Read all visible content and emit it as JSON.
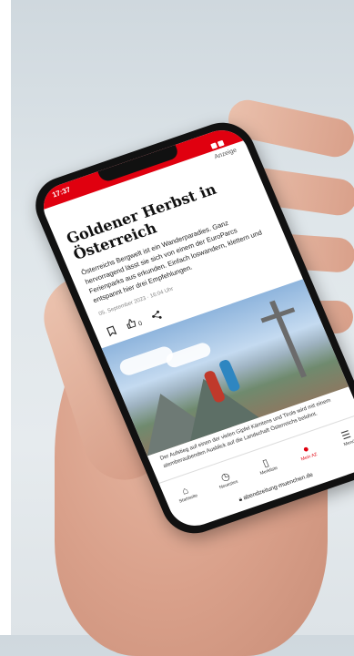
{
  "phone": {
    "status_time": "17:37",
    "ad_label": "Anzeige",
    "article": {
      "headline": "Goldener Herbst in Österreich",
      "teaser": "Österreichs Bergwelt ist ein Wanderparadies. Ganz hervorragend lässt sie sich von einem der EuroParcs Ferienparks aus erkunden. Einfach loswandern, klettern und entspannt hier drei Empfehlungen.",
      "date": "05. September 2023 · 16:04 Uhr",
      "like_count": "0",
      "caption": "Der Aufstieg auf einen der vielen Gipfel Kärntens und Tirols wird mit einem atemberaubenden Ausblick auf die Landschaft Österreichs belohnt."
    },
    "tabs": [
      {
        "label": "Startseite",
        "icon": "home-icon",
        "glyph": "⌂"
      },
      {
        "label": "Neuestes",
        "icon": "clock-icon",
        "glyph": "◷"
      },
      {
        "label": "Merkliste",
        "icon": "bookmark-icon",
        "glyph": "▯"
      },
      {
        "label": "Mein AZ",
        "icon": "user-icon",
        "glyph": "●"
      },
      {
        "label": "Menü",
        "icon": "menu-icon",
        "glyph": "☰"
      }
    ],
    "url": "abendzeitung-muenchen.de",
    "colors": {
      "brand": "#e0000f"
    }
  }
}
